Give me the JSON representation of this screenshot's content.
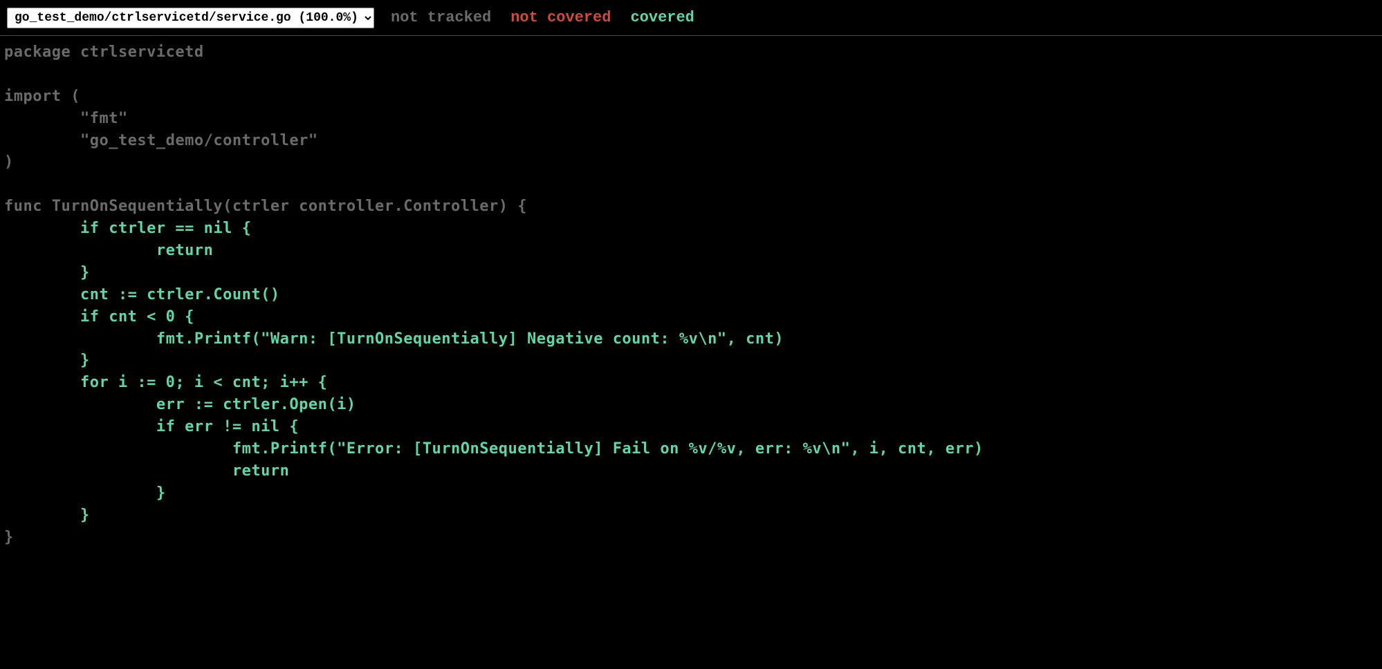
{
  "topbar": {
    "selected_file": "go_test_demo/ctrlservicetd/service.go (100.0%)",
    "legend": {
      "not_tracked": "not tracked",
      "not_covered": "not covered",
      "covered": "covered"
    }
  },
  "code": {
    "lines": [
      {
        "class": "not-tracked",
        "text": "package ctrlservicetd"
      },
      {
        "class": "not-tracked",
        "text": ""
      },
      {
        "class": "not-tracked",
        "text": "import ("
      },
      {
        "class": "not-tracked",
        "text": "        \"fmt\""
      },
      {
        "class": "not-tracked",
        "text": "        \"go_test_demo/controller\""
      },
      {
        "class": "not-tracked",
        "text": ")"
      },
      {
        "class": "not-tracked",
        "text": ""
      },
      {
        "class": "not-tracked",
        "text": "func TurnOnSequentially(ctrler controller.Controller) {"
      },
      {
        "class": "covered",
        "text": "        if ctrler == nil {"
      },
      {
        "class": "covered",
        "text": "                return"
      },
      {
        "class": "covered",
        "text": "        }"
      },
      {
        "class": "covered",
        "text": "        cnt := ctrler.Count()"
      },
      {
        "class": "covered",
        "text": "        if cnt < 0 {"
      },
      {
        "class": "covered",
        "text": "                fmt.Printf(\"Warn: [TurnOnSequentially] Negative count: %v\\n\", cnt)"
      },
      {
        "class": "covered",
        "text": "        }"
      },
      {
        "class": "covered",
        "text": "        for i := 0; i < cnt; i++ {"
      },
      {
        "class": "covered",
        "text": "                err := ctrler.Open(i)"
      },
      {
        "class": "covered",
        "text": "                if err != nil {"
      },
      {
        "class": "covered",
        "text": "                        fmt.Printf(\"Error: [TurnOnSequentially] Fail on %v/%v, err: %v\\n\", i, cnt, err)"
      },
      {
        "class": "covered",
        "text": "                        return"
      },
      {
        "class": "covered",
        "text": "                }"
      },
      {
        "class": "covered",
        "text": "        }"
      },
      {
        "class": "not-tracked",
        "text": "}"
      }
    ]
  }
}
